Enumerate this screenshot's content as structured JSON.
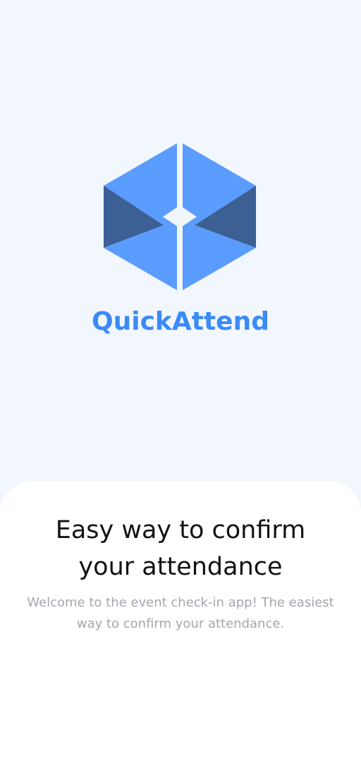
{
  "brand": {
    "app_name": "QuickAttend",
    "logo_icon": "hexagon-cube-logo-icon",
    "colors": {
      "background": "#F2F7FE",
      "primary": "#3B8AF7",
      "logo_light": "#5B9CFF",
      "logo_dark": "#3C5F94",
      "sheet": "#FFFFFF"
    }
  },
  "onboarding": {
    "title": "Easy way to confirm your attendance",
    "description": "Welcome to the event check-in app! The easiest way to confirm your attendance."
  }
}
